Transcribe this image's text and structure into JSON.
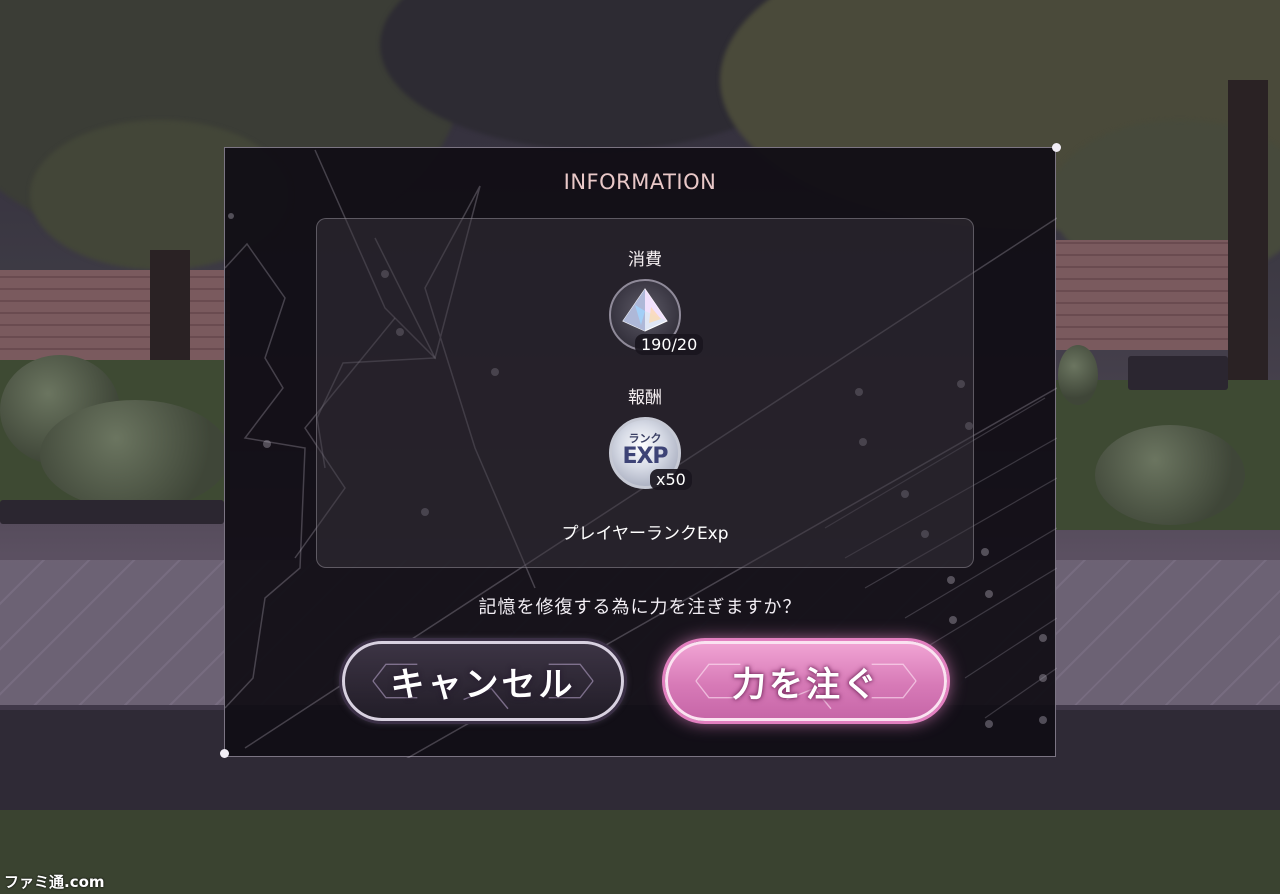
{
  "dialog": {
    "title": "INFORMATION",
    "cost": {
      "label": "消費",
      "icon": "crystal-icon",
      "count": "190/20"
    },
    "reward": {
      "label": "報酬",
      "icon": "rank-exp-icon",
      "icon_text_top": "ランク",
      "icon_text_main": "EXP",
      "count": "x50",
      "name": "プレイヤーランクExp"
    },
    "question": "記憶を修復する為に力を注ぎますか？",
    "cancel_label": "キャンセル",
    "confirm_label": "力を注ぐ"
  },
  "watermark": "ファミ通.com",
  "colors": {
    "title": "#e9c8c8",
    "confirm": "#d77ab7",
    "cancel": "#2a2230",
    "dialog_bg": "#100d14"
  }
}
